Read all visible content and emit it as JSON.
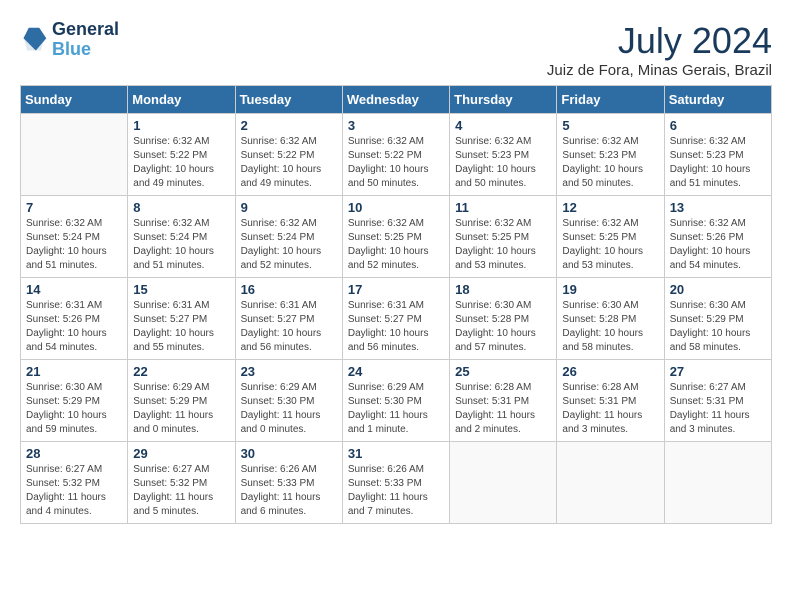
{
  "logo": {
    "text_general": "General",
    "text_blue": "Blue"
  },
  "header": {
    "title": "July 2024",
    "subtitle": "Juiz de Fora, Minas Gerais, Brazil"
  },
  "weekdays": [
    "Sunday",
    "Monday",
    "Tuesday",
    "Wednesday",
    "Thursday",
    "Friday",
    "Saturday"
  ],
  "weeks": [
    [
      {
        "day": "",
        "sunrise": "",
        "sunset": "",
        "daylight": ""
      },
      {
        "day": "1",
        "sunrise": "Sunrise: 6:32 AM",
        "sunset": "Sunset: 5:22 PM",
        "daylight": "Daylight: 10 hours and 49 minutes."
      },
      {
        "day": "2",
        "sunrise": "Sunrise: 6:32 AM",
        "sunset": "Sunset: 5:22 PM",
        "daylight": "Daylight: 10 hours and 49 minutes."
      },
      {
        "day": "3",
        "sunrise": "Sunrise: 6:32 AM",
        "sunset": "Sunset: 5:22 PM",
        "daylight": "Daylight: 10 hours and 50 minutes."
      },
      {
        "day": "4",
        "sunrise": "Sunrise: 6:32 AM",
        "sunset": "Sunset: 5:23 PM",
        "daylight": "Daylight: 10 hours and 50 minutes."
      },
      {
        "day": "5",
        "sunrise": "Sunrise: 6:32 AM",
        "sunset": "Sunset: 5:23 PM",
        "daylight": "Daylight: 10 hours and 50 minutes."
      },
      {
        "day": "6",
        "sunrise": "Sunrise: 6:32 AM",
        "sunset": "Sunset: 5:23 PM",
        "daylight": "Daylight: 10 hours and 51 minutes."
      }
    ],
    [
      {
        "day": "7",
        "sunrise": "Sunrise: 6:32 AM",
        "sunset": "Sunset: 5:24 PM",
        "daylight": "Daylight: 10 hours and 51 minutes."
      },
      {
        "day": "8",
        "sunrise": "Sunrise: 6:32 AM",
        "sunset": "Sunset: 5:24 PM",
        "daylight": "Daylight: 10 hours and 51 minutes."
      },
      {
        "day": "9",
        "sunrise": "Sunrise: 6:32 AM",
        "sunset": "Sunset: 5:24 PM",
        "daylight": "Daylight: 10 hours and 52 minutes."
      },
      {
        "day": "10",
        "sunrise": "Sunrise: 6:32 AM",
        "sunset": "Sunset: 5:25 PM",
        "daylight": "Daylight: 10 hours and 52 minutes."
      },
      {
        "day": "11",
        "sunrise": "Sunrise: 6:32 AM",
        "sunset": "Sunset: 5:25 PM",
        "daylight": "Daylight: 10 hours and 53 minutes."
      },
      {
        "day": "12",
        "sunrise": "Sunrise: 6:32 AM",
        "sunset": "Sunset: 5:25 PM",
        "daylight": "Daylight: 10 hours and 53 minutes."
      },
      {
        "day": "13",
        "sunrise": "Sunrise: 6:32 AM",
        "sunset": "Sunset: 5:26 PM",
        "daylight": "Daylight: 10 hours and 54 minutes."
      }
    ],
    [
      {
        "day": "14",
        "sunrise": "Sunrise: 6:31 AM",
        "sunset": "Sunset: 5:26 PM",
        "daylight": "Daylight: 10 hours and 54 minutes."
      },
      {
        "day": "15",
        "sunrise": "Sunrise: 6:31 AM",
        "sunset": "Sunset: 5:27 PM",
        "daylight": "Daylight: 10 hours and 55 minutes."
      },
      {
        "day": "16",
        "sunrise": "Sunrise: 6:31 AM",
        "sunset": "Sunset: 5:27 PM",
        "daylight": "Daylight: 10 hours and 56 minutes."
      },
      {
        "day": "17",
        "sunrise": "Sunrise: 6:31 AM",
        "sunset": "Sunset: 5:27 PM",
        "daylight": "Daylight: 10 hours and 56 minutes."
      },
      {
        "day": "18",
        "sunrise": "Sunrise: 6:30 AM",
        "sunset": "Sunset: 5:28 PM",
        "daylight": "Daylight: 10 hours and 57 minutes."
      },
      {
        "day": "19",
        "sunrise": "Sunrise: 6:30 AM",
        "sunset": "Sunset: 5:28 PM",
        "daylight": "Daylight: 10 hours and 58 minutes."
      },
      {
        "day": "20",
        "sunrise": "Sunrise: 6:30 AM",
        "sunset": "Sunset: 5:29 PM",
        "daylight": "Daylight: 10 hours and 58 minutes."
      }
    ],
    [
      {
        "day": "21",
        "sunrise": "Sunrise: 6:30 AM",
        "sunset": "Sunset: 5:29 PM",
        "daylight": "Daylight: 10 hours and 59 minutes."
      },
      {
        "day": "22",
        "sunrise": "Sunrise: 6:29 AM",
        "sunset": "Sunset: 5:29 PM",
        "daylight": "Daylight: 11 hours and 0 minutes."
      },
      {
        "day": "23",
        "sunrise": "Sunrise: 6:29 AM",
        "sunset": "Sunset: 5:30 PM",
        "daylight": "Daylight: 11 hours and 0 minutes."
      },
      {
        "day": "24",
        "sunrise": "Sunrise: 6:29 AM",
        "sunset": "Sunset: 5:30 PM",
        "daylight": "Daylight: 11 hours and 1 minute."
      },
      {
        "day": "25",
        "sunrise": "Sunrise: 6:28 AM",
        "sunset": "Sunset: 5:31 PM",
        "daylight": "Daylight: 11 hours and 2 minutes."
      },
      {
        "day": "26",
        "sunrise": "Sunrise: 6:28 AM",
        "sunset": "Sunset: 5:31 PM",
        "daylight": "Daylight: 11 hours and 3 minutes."
      },
      {
        "day": "27",
        "sunrise": "Sunrise: 6:27 AM",
        "sunset": "Sunset: 5:31 PM",
        "daylight": "Daylight: 11 hours and 3 minutes."
      }
    ],
    [
      {
        "day": "28",
        "sunrise": "Sunrise: 6:27 AM",
        "sunset": "Sunset: 5:32 PM",
        "daylight": "Daylight: 11 hours and 4 minutes."
      },
      {
        "day": "29",
        "sunrise": "Sunrise: 6:27 AM",
        "sunset": "Sunset: 5:32 PM",
        "daylight": "Daylight: 11 hours and 5 minutes."
      },
      {
        "day": "30",
        "sunrise": "Sunrise: 6:26 AM",
        "sunset": "Sunset: 5:33 PM",
        "daylight": "Daylight: 11 hours and 6 minutes."
      },
      {
        "day": "31",
        "sunrise": "Sunrise: 6:26 AM",
        "sunset": "Sunset: 5:33 PM",
        "daylight": "Daylight: 11 hours and 7 minutes."
      },
      {
        "day": "",
        "sunrise": "",
        "sunset": "",
        "daylight": ""
      },
      {
        "day": "",
        "sunrise": "",
        "sunset": "",
        "daylight": ""
      },
      {
        "day": "",
        "sunrise": "",
        "sunset": "",
        "daylight": ""
      }
    ]
  ]
}
